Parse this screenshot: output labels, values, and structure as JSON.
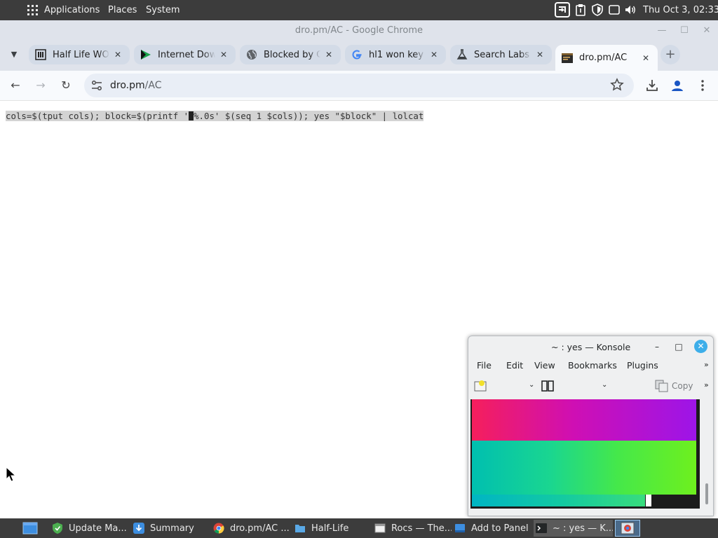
{
  "top_panel": {
    "menus": [
      "Applications",
      "Places",
      "System"
    ],
    "clock": "Thu Oct  3, 02:33"
  },
  "browser": {
    "window_title": "dro.pm/AC - Google Chrome",
    "tabs": [
      {
        "label": "Half Life WON",
        "icon": "museum-icon"
      },
      {
        "label": "Internet Down",
        "icon": "play-icon"
      },
      {
        "label": "Blocked by C",
        "icon": "globe-icon"
      },
      {
        "label": "hl1 won key",
        "icon": "google-icon"
      },
      {
        "label": "Search Labs",
        "icon": "labs-flask-icon"
      },
      {
        "label": "dro.pm/AC",
        "icon": "terminal-favicon-icon",
        "active": true
      }
    ],
    "url_host": "dro.pm",
    "url_path": "/AC"
  },
  "page": {
    "command_before": "cols=$(tput cols); block=$(printf '",
    "command_after": "%.0s' $(seq 1 $cols)); yes \"$block\" | lolcat"
  },
  "konsole": {
    "title": "~ : yes — Konsole",
    "menus": [
      "File",
      "Edit",
      "View",
      "Bookmarks",
      "Plugins"
    ],
    "overflow": "»",
    "copy_label": "Copy"
  },
  "taskbar": {
    "items": [
      {
        "label": "",
        "icon": "show-desktop-icon"
      },
      {
        "label": "Update Ma...",
        "icon": "update-shield-icon"
      },
      {
        "label": "Summary",
        "icon": "download-icon"
      },
      {
        "label": "dro.pm/AC ...",
        "icon": "chrome-icon"
      },
      {
        "label": "Half-Life",
        "icon": "folder-icon"
      },
      {
        "label": "Rocs — The...",
        "icon": "rocs-icon"
      },
      {
        "label": "Add to Panel",
        "icon": "panel-icon"
      },
      {
        "label": "~ : yes — K...",
        "icon": "konsole-icon",
        "active": true
      },
      {
        "label": "",
        "icon": "screenshot-icon"
      }
    ]
  }
}
